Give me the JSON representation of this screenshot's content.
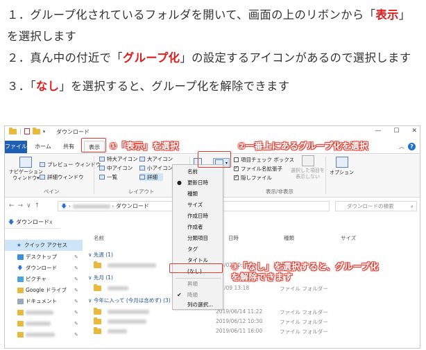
{
  "instructions": {
    "step1_prefix": "１．グループ化されているフォルダを開いて、画面の上のリボンから「",
    "step1_highlight": "表示",
    "step1_suffix": "」を選択します",
    "step2_prefix": "２．真ん中の付近で「",
    "step2_highlight": "グループ化",
    "step2_suffix": "」の設定するアイコンがあるので選択します",
    "step3_prefix": "３．「",
    "step3_highlight": "なし",
    "step3_suffix": "」を選択すると、グループ化を解除できます"
  },
  "window": {
    "title": "ダウンロード",
    "tabs": {
      "file": "ファイル",
      "home": "ホーム",
      "share": "共有",
      "view": "表示"
    },
    "help": "?",
    "controls": {
      "minimize": "—",
      "maximize": "☐",
      "close": "✕"
    }
  },
  "ribbon": {
    "nav_pane": "ナビゲーション\nウィンドウ▾",
    "preview_pane": "プレビュー ウィンドウ",
    "details_pane": "詳細ウィンドウ",
    "pane_group": "ペイン",
    "layout_items": [
      "特大アイコン",
      "大アイコン",
      "中アイコン",
      "小アイコン",
      "一覧",
      "詳細"
    ],
    "layout_group": "レイアウト",
    "check_item_checkbox": "項目チェック ボックス",
    "check_extensions": "ファイル名拡張子",
    "check_hidden": "隠しファイル",
    "hide_selected": "選択した項目を\n表示しない",
    "options": "オプション",
    "show_hide_group": "表示/非表示"
  },
  "address": {
    "current": "ダウンロード",
    "search_placeholder": "ダウンロードの検索"
  },
  "nav_tab": {
    "label": "ダウンロード",
    "close": "x"
  },
  "sidebar": {
    "items": [
      {
        "label": "クイック アクセス"
      },
      {
        "label": "デスクトップ"
      },
      {
        "label": "ダウンロード"
      },
      {
        "label": "ピクチャ"
      },
      {
        "label": "Google ドライブ"
      },
      {
        "label": "ドキュメント"
      }
    ]
  },
  "content": {
    "col_name": "名前",
    "col_date": "日時",
    "col_type": "種類",
    "col_size": "サイズ",
    "groups": [
      "先週 (1)",
      "先月 (1)",
      "今年に入って (今月は含めず) (3)"
    ],
    "rows": [
      {
        "date": "/08/02 10:39",
        "kind": "ファイル フォルダー"
      },
      {
        "date": "/07/09 13:18",
        "kind": "ファイル フォルダー"
      },
      {
        "date": "2019/06/14 11:22",
        "kind": "ファイル フォルダー"
      },
      {
        "date": "2019/06/12 10:30",
        "kind": "ファイル フォルダー"
      },
      {
        "date": "2019/06/11 16:00",
        "kind": "ファイル フォルダー"
      }
    ]
  },
  "groupby_menu": {
    "items": [
      "名前",
      "更新日時",
      "種類",
      "サイズ",
      "作成日時",
      "作成者",
      "分類項目",
      "タグ",
      "タイトル",
      "(なし)",
      "昇順",
      "降順",
      "列の選択..."
    ],
    "selected_field": "更新日時",
    "selected_order": "降順"
  },
  "annotations": {
    "a1": "①「表示」を選択",
    "a2": "②一番上にあるグループ化を選択",
    "a3": "③「なし」を選択すると、グループ化\nを解除できます",
    "color": "#e23b2f"
  }
}
